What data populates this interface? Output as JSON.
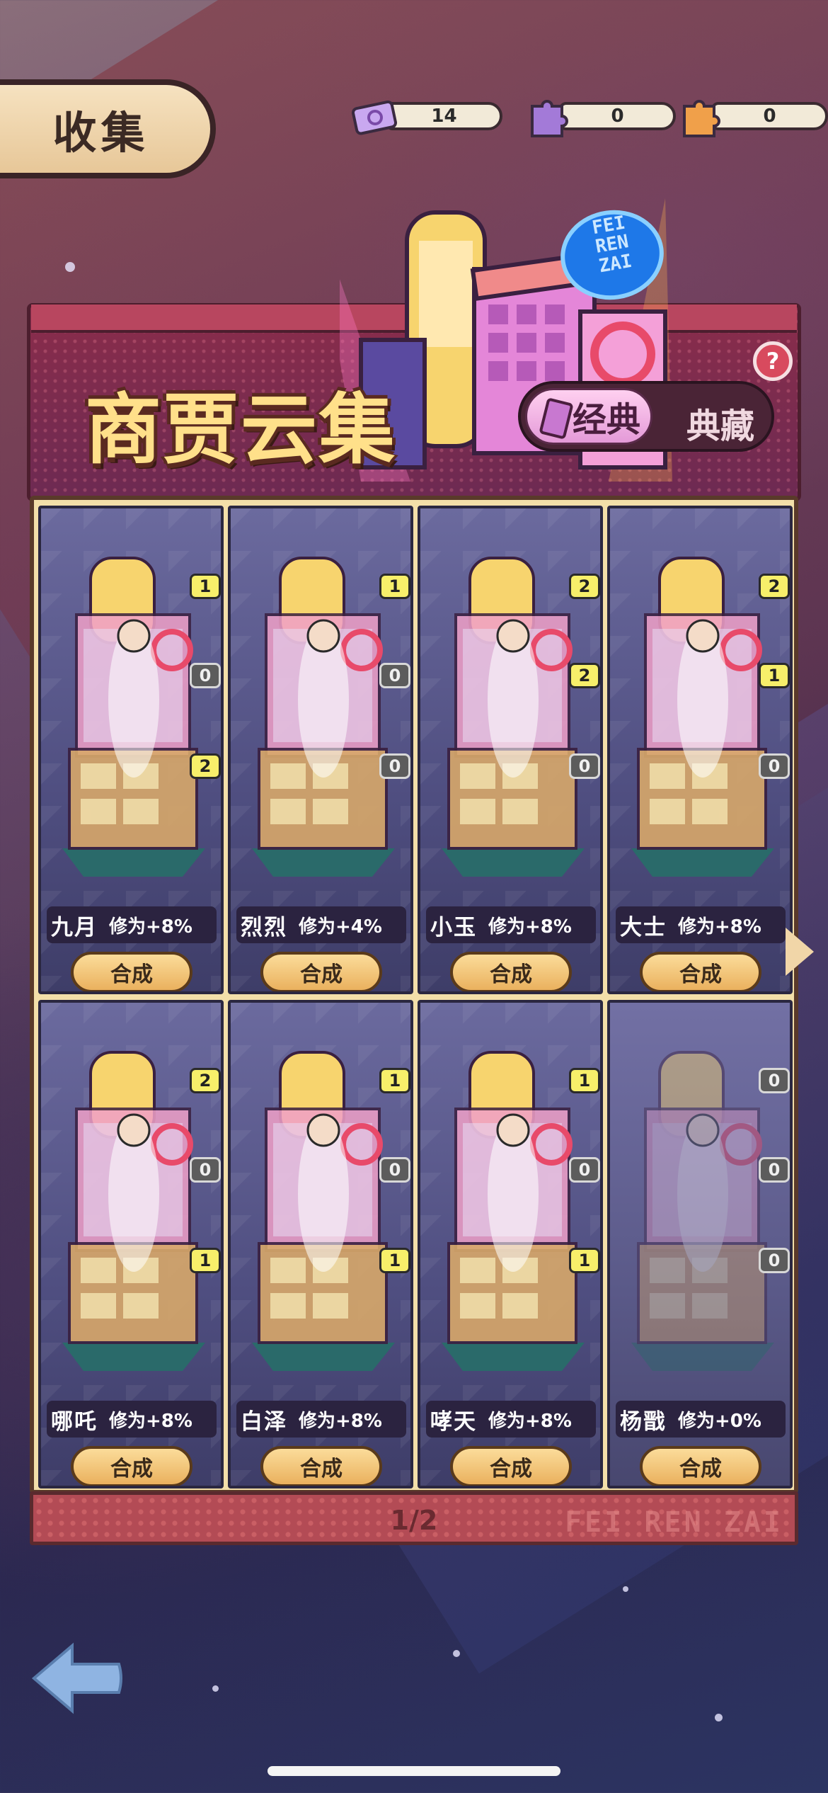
{
  "header": {
    "title": "收集"
  },
  "currency": [
    {
      "icon": "ticket-icon",
      "value": "14"
    },
    {
      "icon": "purple-puzzle-icon",
      "value": "0"
    },
    {
      "icon": "orange-puzzle-icon",
      "value": "0"
    }
  ],
  "banner": {
    "title": "商贾云集",
    "sign_text": "FEI REN ZAI",
    "help": "?",
    "tabs": {
      "active": "经典",
      "inactive": "典藏"
    }
  },
  "cards": [
    {
      "name": "九月",
      "bonus": "修为+8%",
      "button": "合成",
      "counts": [
        "1",
        "0",
        "2"
      ]
    },
    {
      "name": "烈烈",
      "bonus": "修为+4%",
      "button": "合成",
      "counts": [
        "1",
        "0",
        "0"
      ]
    },
    {
      "name": "小玉",
      "bonus": "修为+8%",
      "button": "合成",
      "counts": [
        "2",
        "2",
        "0"
      ]
    },
    {
      "name": "大士",
      "bonus": "修为+8%",
      "button": "合成",
      "counts": [
        "2",
        "1",
        "0"
      ]
    },
    {
      "name": "哪吒",
      "bonus": "修为+8%",
      "button": "合成",
      "counts": [
        "2",
        "0",
        "1"
      ]
    },
    {
      "name": "白泽",
      "bonus": "修为+8%",
      "button": "合成",
      "counts": [
        "1",
        "0",
        "1"
      ]
    },
    {
      "name": "哮天",
      "bonus": "修为+8%",
      "button": "合成",
      "counts": [
        "1",
        "0",
        "1"
      ]
    },
    {
      "name": "杨戬",
      "bonus": "修为+0%",
      "button": "合成",
      "counts": [
        "0",
        "0",
        "0"
      ]
    }
  ],
  "pager": {
    "page": "1/2",
    "brand": "FEI REN ZAI"
  },
  "colors": {
    "accent": "#ffe08a",
    "panel": "#f3dfa9",
    "badge_yellow": "#f7ef6a",
    "badge_gray": "#5c5c5c"
  }
}
